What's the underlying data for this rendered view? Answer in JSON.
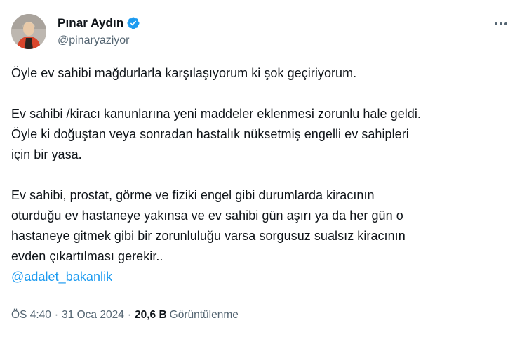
{
  "author": {
    "display_name": "Pınar Aydın",
    "handle": "@pinaryaziyor",
    "verified": true
  },
  "tweet": {
    "lines_p1": [
      "Öyle ev sahibi mağdurlarla karşılaşıyorum ki şok geçiriyorum."
    ],
    "lines_p2": [
      "Ev sahibi /kiracı kanunlarına yeni maddeler eklenmesi zorunlu hale geldi.",
      "Öyle ki doğuştan veya sonradan hastalık nüksetmiş engelli ev sahipleri",
      "için bir yasa."
    ],
    "lines_p3": [
      "Ev sahibi, prostat, görme ve fiziki engel gibi durumlarda kiracının",
      "oturduğu ev hastaneye yakınsa ve ev sahibi gün aşırı ya da her gün o",
      "hastaneye gitmek gibi bir zorunluluğu varsa sorgusuz sualsız kiracının",
      "evden çıkartılması gerekir.."
    ],
    "mention": "@adalet_bakanlik"
  },
  "meta": {
    "time": "ÖS 4:40",
    "separator": "·",
    "date": "31 Oca 2024",
    "views_count": "20,6 B",
    "views_label": "Görüntülenme"
  },
  "colors": {
    "text": "#0f1419",
    "secondary": "#536471",
    "link": "#1d9bf0",
    "verified": "#1d9bf0"
  },
  "icons": {
    "verified": "verified-badge-icon",
    "more": "more-options-icon"
  }
}
